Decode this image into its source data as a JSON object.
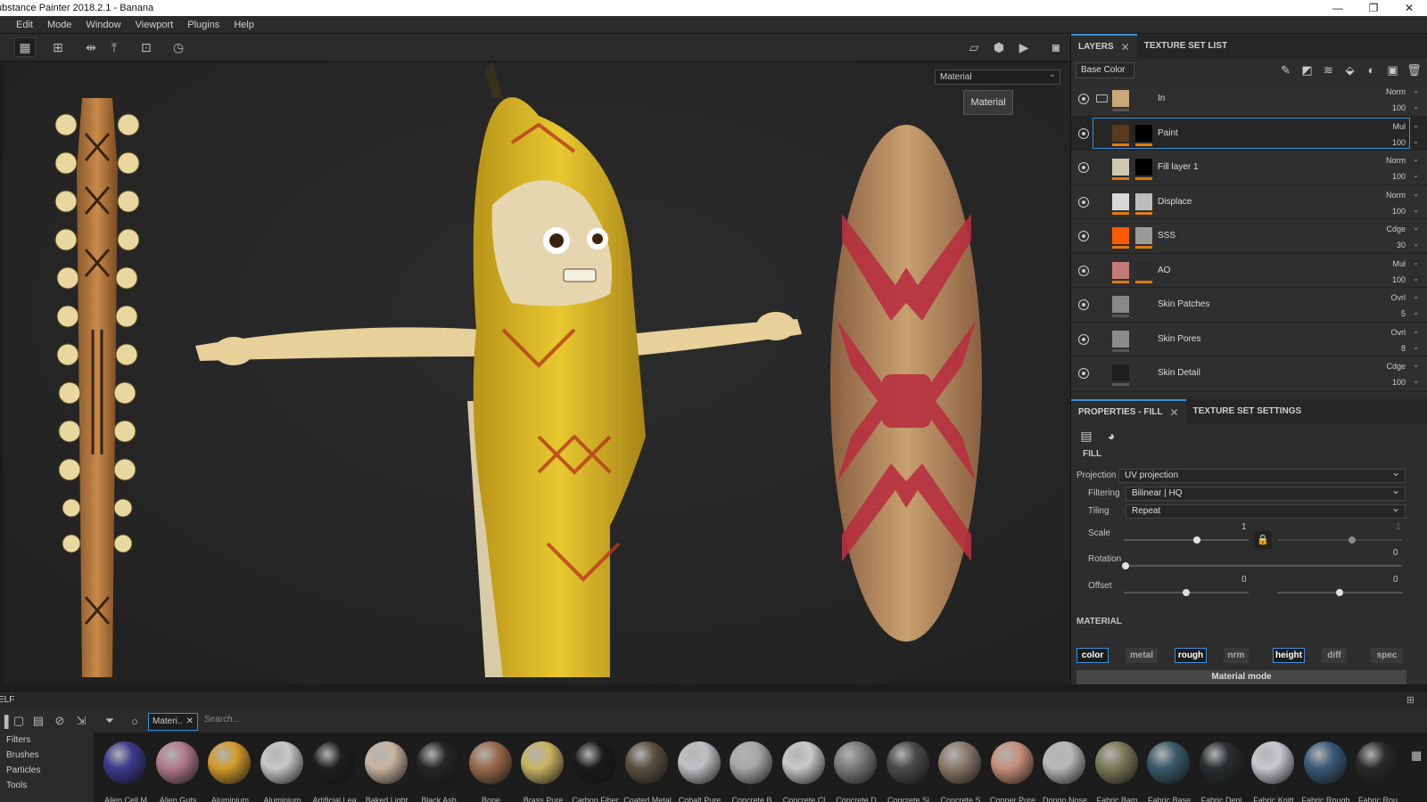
{
  "app": {
    "title": "ubstance Painter 2018.2.1 - Banana"
  },
  "window_buttons": [
    "—",
    "❐",
    "✕"
  ],
  "menu": [
    "Edit",
    "Mode",
    "Window",
    "Viewport",
    "Plugins",
    "Help"
  ],
  "viewport": {
    "mode_select": "Material",
    "tooltip": "Material"
  },
  "layers_panel": {
    "tabs": [
      "LAYERS",
      "TEXTURE SET LIST"
    ],
    "channel_select": "Base Color",
    "layers": [
      {
        "name": "In",
        "blend": "Norm",
        "opacity": "100",
        "thumb1": "#c9a878",
        "thumb2": null,
        "bar": "#555555",
        "folder": true,
        "selected": false
      },
      {
        "name": "Paint",
        "blend": "Mul",
        "opacity": "100",
        "thumb1": "#5a3a1c",
        "thumb2": "#000000",
        "bar": "#e07a10",
        "folder": false,
        "selected": true
      },
      {
        "name": "Fill layer 1",
        "blend": "Norm",
        "opacity": "100",
        "thumb1": "#cfc6b4",
        "thumb2": "#000000",
        "bar": "#e07a10",
        "folder": false,
        "selected": false
      },
      {
        "name": "Displace",
        "blend": "Norm",
        "opacity": "100",
        "thumb1": "#d8d8d8",
        "thumb2": "#bdbdbd",
        "bar": "#e07a10",
        "folder": false,
        "selected": false
      },
      {
        "name": "SSS",
        "blend": "Cdge",
        "opacity": "30",
        "thumb1": "#ff5a00",
        "thumb2": "#9a9a9a",
        "bar": "#e07a10",
        "folder": false,
        "selected": false
      },
      {
        "name": "AO",
        "blend": "Mul",
        "opacity": "100",
        "thumb1": "#c47a7a",
        "thumb2": "#2a2a2a",
        "bar": "#e07a10",
        "folder": false,
        "selected": false
      },
      {
        "name": "Skin Patches",
        "blend": "Ovrl",
        "opacity": "5",
        "thumb1": "#888888",
        "thumb2": null,
        "bar": "#555555",
        "folder": false,
        "selected": false
      },
      {
        "name": "Skin Pores",
        "blend": "Ovrl",
        "opacity": "8",
        "thumb1": "#8c8c8c",
        "thumb2": null,
        "bar": "#555555",
        "folder": false,
        "selected": false
      },
      {
        "name": "Skin Detail",
        "blend": "Cdge",
        "opacity": "100",
        "thumb1": "#1e1e1e",
        "thumb2": null,
        "bar": "#555555",
        "folder": false,
        "selected": false
      }
    ]
  },
  "properties": {
    "tabs": [
      "PROPERTIES - FILL",
      "TEXTURE SET SETTINGS"
    ],
    "fill_title": "FILL",
    "projection_label": "Projection",
    "projection_value": "UV projection",
    "filtering_label": "Filtering",
    "filtering_value": "Bilinear | HQ",
    "tiling_label": "Tiling",
    "tiling_value": "Repeat",
    "scale_label": "Scale",
    "scale_value": "1",
    "scale_value2": "1",
    "rotation_label": "Rotation",
    "rotation_value": "0",
    "offset_label": "Offset",
    "offset_x": "0",
    "offset_y": "0",
    "material_title": "MATERIAL",
    "channels": [
      {
        "label": "color",
        "on": true
      },
      {
        "label": "metal",
        "on": false
      },
      {
        "label": "rough",
        "on": true
      },
      {
        "label": "nrm",
        "on": false
      },
      {
        "label": "height",
        "on": true
      },
      {
        "label": "diff",
        "on": false
      },
      {
        "label": "spec",
        "on": false
      }
    ],
    "material_mode": "Material mode"
  },
  "shelf": {
    "title": "ELF",
    "filter_chip": "Materi..",
    "search_placeholder": "Search...",
    "categories": [
      "Filters",
      "Brushes",
      "Particles",
      "Tools"
    ],
    "materials": [
      {
        "name": "Alien Cell M",
        "color": "#3b3a8c"
      },
      {
        "name": "Alien Guts",
        "color": "#b07a8c"
      },
      {
        "name": "Aluminium",
        "color": "#d49a2a"
      },
      {
        "name": "Aluminium",
        "color": "#c8c8c8"
      },
      {
        "name": "Artificial Lea",
        "color": "#1e1e1e"
      },
      {
        "name": "Baked Light",
        "color": "#c8b4a0"
      },
      {
        "name": "Black Ash",
        "color": "#262626"
      },
      {
        "name": "Bone",
        "color": "#9a6a4a"
      },
      {
        "name": "Brass Pure",
        "color": "#c8b460"
      },
      {
        "name": "Carbon Fiber",
        "color": "#1a1a1a"
      },
      {
        "name": "Coated Metal",
        "color": "#5a5040"
      },
      {
        "name": "Cobalt Pure",
        "color": "#c0c0c4"
      },
      {
        "name": "Concrete B",
        "color": "#a8a8a8"
      },
      {
        "name": "Concrete Cl",
        "color": "#c8c8c8"
      },
      {
        "name": "Concrete D",
        "color": "#7a7a7a"
      },
      {
        "name": "Concrete Si",
        "color": "#4a4a4a"
      },
      {
        "name": "Concrete S",
        "color": "#8a7a6a"
      },
      {
        "name": "Copper Pure",
        "color": "#c8907a"
      },
      {
        "name": "Dongo Nose",
        "color": "#b8b8b8"
      },
      {
        "name": "Fabric Bam",
        "color": "#7a7a5a"
      },
      {
        "name": "Fabric Base",
        "color": "#3a5a6a"
      },
      {
        "name": "Fabric Deni",
        "color": "#2a2e30"
      },
      {
        "name": "Fabric Knitt",
        "color": "#c8c8d0"
      },
      {
        "name": "Fabric Rough",
        "color": "#3a5a7a"
      },
      {
        "name": "Fabric Rou",
        "color": "#2a2a2a"
      }
    ]
  }
}
